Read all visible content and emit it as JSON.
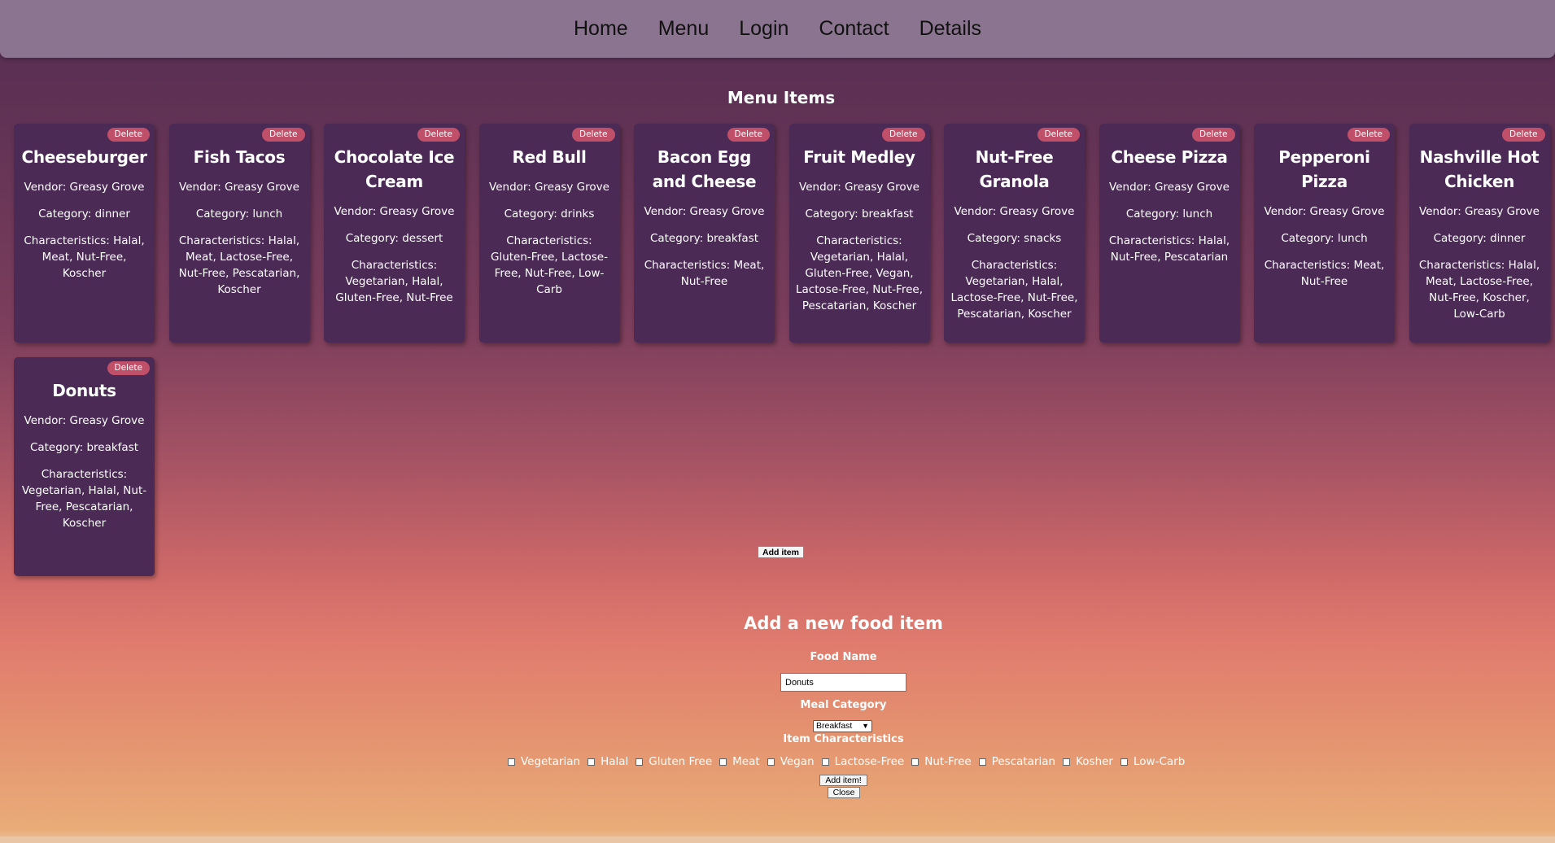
{
  "nav": {
    "links": [
      "Home",
      "Menu",
      "Login",
      "Contact",
      "Details"
    ]
  },
  "menu": {
    "title": "Menu Items",
    "delete_label": "Delete",
    "items": [
      {
        "name": "Cheeseburger",
        "vendor": "Vendor: Greasy Grove",
        "category": "Category: dinner",
        "characteristics": "Characteristics: Halal, Meat, Nut-Free, Koscher"
      },
      {
        "name": "Fish Tacos",
        "vendor": "Vendor: Greasy Grove",
        "category": "Category: lunch",
        "characteristics": "Characteristics: Halal, Meat, Lactose-Free, Nut-Free, Pescatarian, Koscher"
      },
      {
        "name": "Chocolate Ice Cream",
        "vendor": "Vendor: Greasy Grove",
        "category": "Category: dessert",
        "characteristics": "Characteristics: Vegetarian, Halal, Gluten-Free, Nut-Free"
      },
      {
        "name": "Red Bull",
        "vendor": "Vendor: Greasy Grove",
        "category": "Category: drinks",
        "characteristics": "Characteristics: Gluten-Free, Lactose-Free, Nut-Free, Low-Carb"
      },
      {
        "name": "Bacon Egg and Cheese",
        "vendor": "Vendor: Greasy Grove",
        "category": "Category: breakfast",
        "characteristics": "Characteristics: Meat, Nut-Free"
      },
      {
        "name": "Fruit Medley",
        "vendor": "Vendor: Greasy Grove",
        "category": "Category: breakfast",
        "characteristics": "Characteristics: Vegetarian, Halal, Gluten-Free, Vegan, Lactose-Free, Nut-Free, Pescatarian, Koscher"
      },
      {
        "name": "Nut-Free Granola",
        "vendor": "Vendor: Greasy Grove",
        "category": "Category: snacks",
        "characteristics": "Characteristics: Vegetarian, Halal, Lactose-Free, Nut-Free, Pescatarian, Koscher"
      },
      {
        "name": "Cheese Pizza",
        "vendor": "Vendor: Greasy Grove",
        "category": "Category: lunch",
        "characteristics": "Characteristics: Halal, Nut-Free, Pescatarian"
      },
      {
        "name": "Pepperoni Pizza",
        "vendor": "Vendor: Greasy Grove",
        "category": "Category: lunch",
        "characteristics": "Characteristics: Meat, Nut-Free"
      },
      {
        "name": "Nashville Hot Chicken",
        "vendor": "Vendor: Greasy Grove",
        "category": "Category: dinner",
        "characteristics": "Characteristics: Halal, Meat, Lactose-Free, Nut-Free, Koscher, Low-Carb"
      },
      {
        "name": "Donuts",
        "vendor": "Vendor: Greasy Grove",
        "category": "Category: breakfast",
        "characteristics": "Characteristics: Vegetarian, Halal, Nut-Free, Pescatarian, Koscher"
      }
    ]
  },
  "add_item_button": "Add item",
  "form": {
    "title": "Add a new food item",
    "food_name_label": "Food Name",
    "food_name_value": "Donuts",
    "meal_category_label": "Meal Category",
    "meal_category_value": "Breakfast",
    "characteristics_label": "Item Characteristics",
    "characteristics": [
      "Vegetarian",
      "Halal",
      "Gluten Free",
      "Meat",
      "Vegan",
      "Lactose-Free",
      "Nut-Free",
      "Pescatarian",
      "Kosher",
      "Low-Carb"
    ],
    "submit_label": "Add item!",
    "close_label": "Close"
  }
}
